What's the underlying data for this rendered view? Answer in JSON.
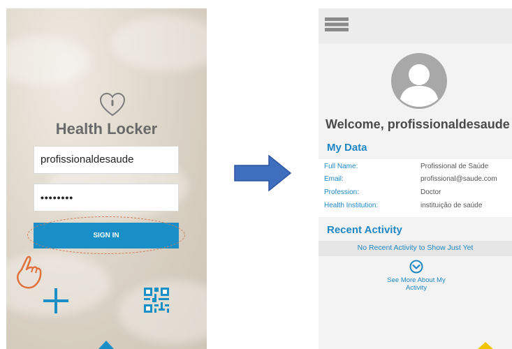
{
  "login": {
    "app_title": "Health Locker",
    "username_value": "profissionaldesaude",
    "password_value": "••••••••",
    "signin_label": "SIGN IN",
    "icons": [
      "heart-lock-icon",
      "hand-pointer-icon",
      "plus-icon",
      "qr-code-icon"
    ]
  },
  "profile": {
    "welcome": "Welcome, profissionaldesaude",
    "my_data_title": "My Data",
    "rows": [
      {
        "label": "Full Name:",
        "value": "Profissional de Saúde"
      },
      {
        "label": "Email:",
        "value": "profissional@saude.com"
      },
      {
        "label": "Profession:",
        "value": "Doctor"
      },
      {
        "label": "Health Institution:",
        "value": "instituição de saúde"
      }
    ],
    "recent_title": "Recent Activity",
    "recent_empty": "No Recent Activity to Show Just Yet",
    "see_more_line1": "See More About My",
    "see_more_line2": "Activity",
    "icons": [
      "menu-icon",
      "avatar-icon",
      "chevron-down-circle-icon"
    ]
  },
  "colors": {
    "accent_blue": "#1f87c3",
    "signin_blue": "#1a8fc7",
    "arrow_blue": "#3e6fbf",
    "hand_orange": "#e0703c",
    "highlight_yellow": "#f0c400"
  }
}
